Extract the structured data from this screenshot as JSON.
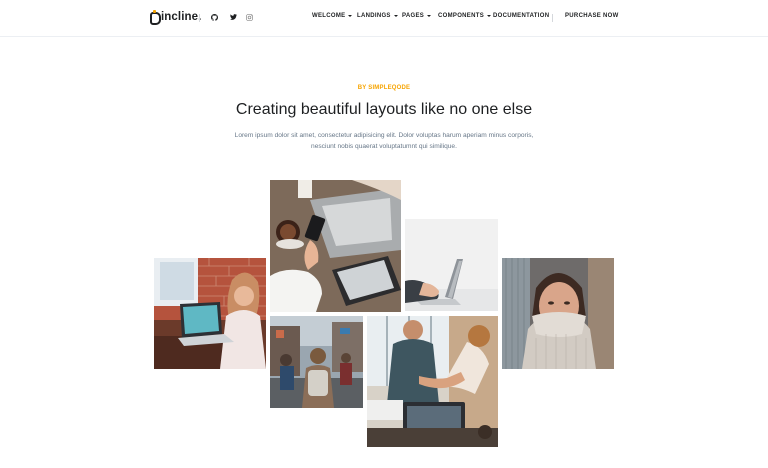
{
  "header": {
    "logo_text": "incline.",
    "social": [
      {
        "icon": "github-icon",
        "glyph": "●"
      },
      {
        "icon": "twitter-icon",
        "glyph": "✦"
      },
      {
        "icon": "instagram-icon",
        "glyph": "◎"
      }
    ],
    "nav": [
      {
        "label": "WELCOME",
        "dropdown": true
      },
      {
        "label": "LANDINGS",
        "dropdown": true
      },
      {
        "label": "PAGES",
        "dropdown": true
      },
      {
        "label": "COMPONENTS",
        "dropdown": true
      },
      {
        "label": "DOCUMENTATION",
        "dropdown": false
      }
    ],
    "cta_label": "PURCHASE NOW"
  },
  "hero": {
    "eyebrow": "BY SIMPLEQODE",
    "title": "Creating beautiful layouts like no one else",
    "description": "Lorem ipsum dolor sit amet, consectetur adipisicing elit. Dolor voluptas harum aperiam minus corporis, nesciunt nobis quaerat voluptatumnt qui similique."
  },
  "gallery": [
    {
      "name": "photo-woman-laptop-brick-wall"
    },
    {
      "name": "photo-coffee-phone-tablet-desk"
    },
    {
      "name": "photo-hand-on-laptop"
    },
    {
      "name": "photo-woman-covering-face"
    },
    {
      "name": "photo-street-backpack"
    },
    {
      "name": "photo-handshake-office"
    }
  ],
  "colors": {
    "accent": "#f7a400",
    "text": "#1e2022",
    "muted": "#677788"
  }
}
